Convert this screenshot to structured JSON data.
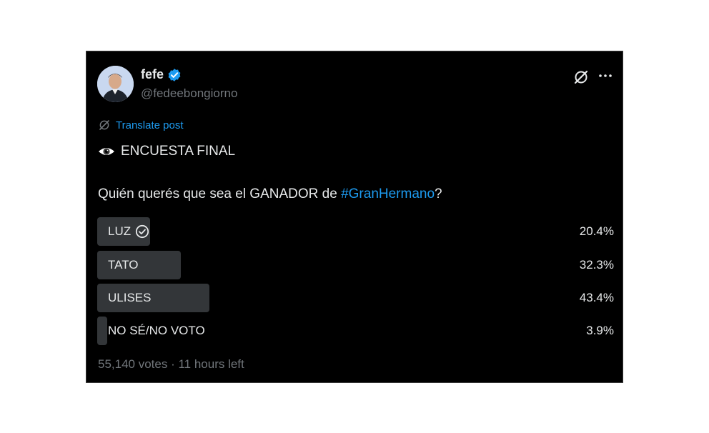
{
  "author": {
    "display_name": "fefe",
    "handle": "@fedeebongiorno",
    "verified_color": "#1d9bf0"
  },
  "icons": {
    "grok": "grok-icon",
    "more": "more-icon",
    "translate": "translate-icon",
    "eye": "eye-emoji-icon",
    "check": "check-circle-icon"
  },
  "translate_label": "Translate post",
  "post": {
    "title": "ENCUESTA FINAL",
    "question_prefix": "Quién querés que sea el GANADOR de ",
    "hashtag": "#GranHermano",
    "question_suffix": "?"
  },
  "poll": {
    "options": [
      {
        "label": "LUZ",
        "percent_text": "20.4%",
        "percent": 20.4,
        "leading": true
      },
      {
        "label": "TATO",
        "percent_text": "32.3%",
        "percent": 32.3,
        "leading": false
      },
      {
        "label": "ULISES",
        "percent_text": "43.4%",
        "percent": 43.4,
        "leading": false
      },
      {
        "label": "NO SÉ/NO VOTO",
        "percent_text": "3.9%",
        "percent": 3.9,
        "leading": false
      }
    ],
    "meta": "55,140 votes · 11 hours left"
  },
  "colors": {
    "background": "#000000",
    "text": "#e7e9ea",
    "secondary": "#71767b",
    "accent": "#1d9bf0",
    "bar": "#333639"
  }
}
